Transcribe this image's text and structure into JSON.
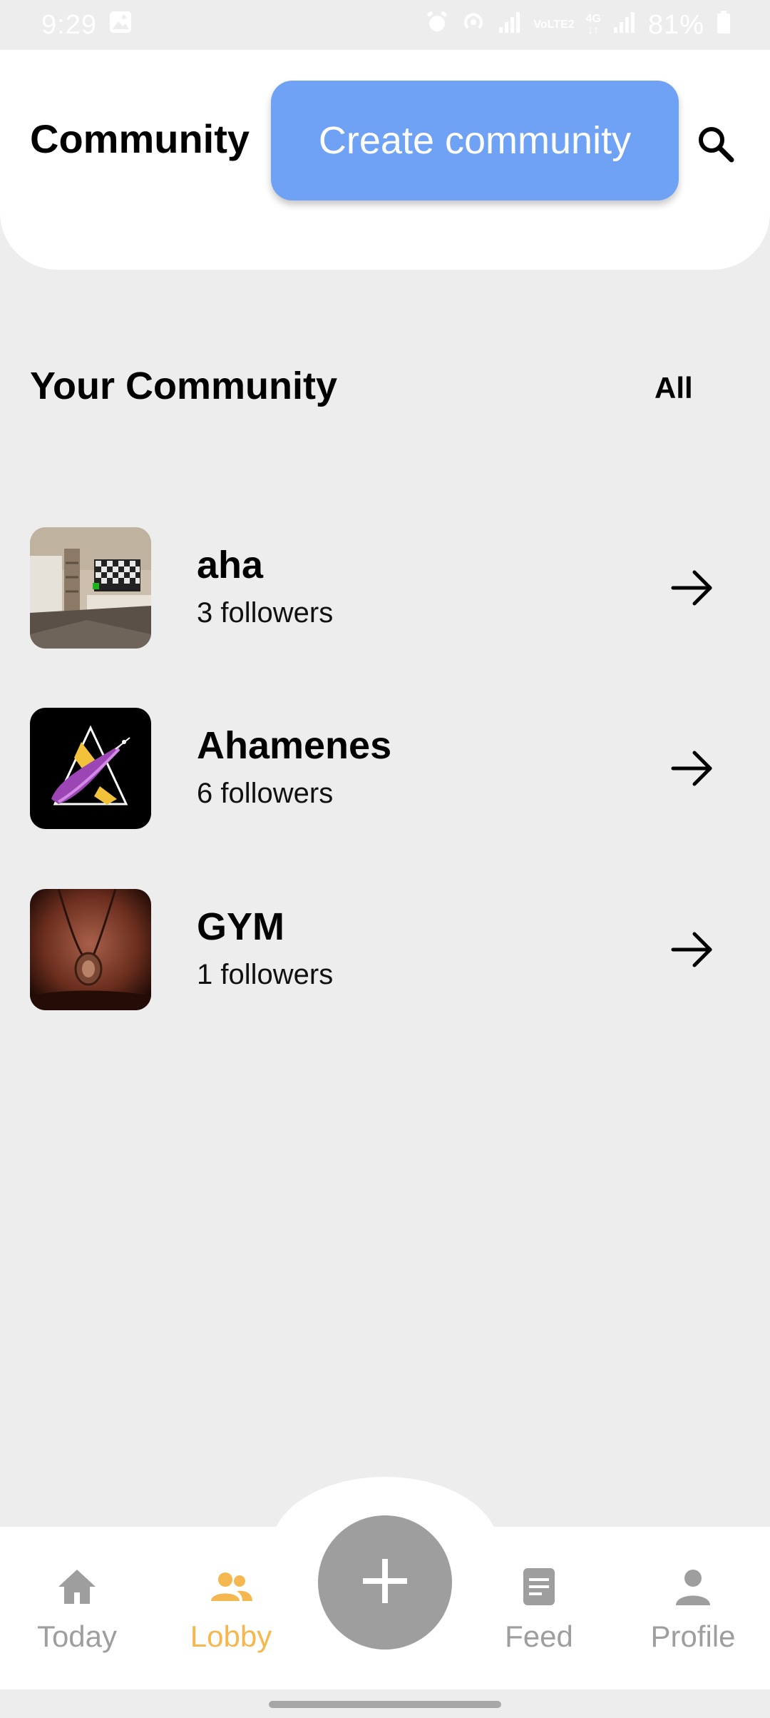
{
  "status_bar": {
    "time": "9:29",
    "battery": "81%",
    "network_volte": "VoLTE2",
    "network_type": "4G",
    "icons": [
      "gallery-icon",
      "alarm-icon",
      "hotspot-icon",
      "signal-icon",
      "signal-icon",
      "battery-icon"
    ]
  },
  "header": {
    "title": "Community",
    "create_button": "Create community",
    "search_icon": "search-icon"
  },
  "section": {
    "title": "Your Community",
    "all_link": "All"
  },
  "communities": [
    {
      "name": "aha",
      "followers": "3 followers",
      "thumbnail": "room-interior-image"
    },
    {
      "name": "Ahamenes",
      "followers": "6 followers",
      "thumbnail": "triangle-logo-image"
    },
    {
      "name": "GYM",
      "followers": "1 followers",
      "thumbnail": "pendant-chest-image"
    }
  ],
  "bottom_nav": {
    "items": [
      {
        "label": "Today",
        "icon": "home-icon",
        "active": false
      },
      {
        "label": "Lobby",
        "icon": "people-icon",
        "active": true
      },
      {
        "label": "Feed",
        "icon": "document-icon",
        "active": false
      },
      {
        "label": "Profile",
        "icon": "person-icon",
        "active": false
      }
    ],
    "fab_icon": "plus-icon"
  },
  "colors": {
    "background": "#ededed",
    "primary_button": "#6fa1f4",
    "active_nav": "#f5b74f",
    "inactive_nav": "#9e9e9e",
    "fab": "#9e9e9e"
  }
}
